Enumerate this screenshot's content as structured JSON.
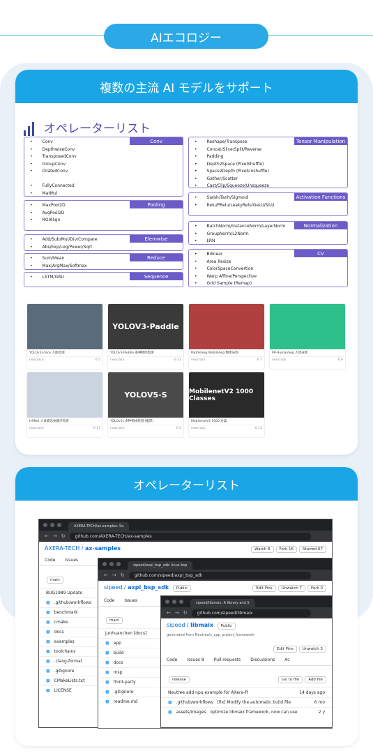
{
  "section_title": "AIエコロジー",
  "card1": {
    "title": "複数の主流 AI モデルをサポート",
    "op_title": "オペレーターリスト",
    "groups_left": [
      {
        "name": "Conv",
        "items": [
          "Conv",
          "DepthwiseConv",
          "TransposedConv",
          "GroupConv",
          "DilatedConv",
          "",
          "FullyConnected",
          "MatMul"
        ]
      },
      {
        "name": "Pooling",
        "items": [
          "MaxPool2D",
          "AvgPool2D",
          "ROIAlign"
        ]
      },
      {
        "name": "Elemwise",
        "items": [
          "Add/Sub/Mul/Div/Compare",
          "Abs/Exp/Log/Power/Sqrt"
        ]
      },
      {
        "name": "Reduce",
        "items": [
          "Sum/Mean",
          "Max/ArgMax/Softmax"
        ]
      },
      {
        "name": "Sequence",
        "items": [
          "LSTM/GRU"
        ]
      }
    ],
    "groups_right": [
      {
        "name": "Tensor Manipulation",
        "items": [
          "Reshape/Transpose",
          "Concat/Slice/Split/Reverse",
          "Padding",
          "Depth2Space (PixelShuffle)",
          "Space2Depth (PixelUnshuffle)",
          "Gather/Scatter",
          "Cast/Clip/Squeeze/Unsqueeze"
        ]
      },
      {
        "name": "Activation Functions",
        "items": [
          "Swish/Tanh/Sigmoid",
          "Relu/PRelu/LeakyRelu/GeLU/SiLU"
        ]
      },
      {
        "name": "Normalization",
        "items": [
          "BatchNorm/InstanceNorm/LayerNorm",
          "GroupNorm/L2Norm",
          "LRN"
        ]
      },
      {
        "name": "CV",
        "items": [
          "Bilinear",
          "Area Resize",
          "ColorSpaceConvertion",
          "Warp Affine/Perspective",
          "Grid Sample (Remap)"
        ]
      }
    ],
    "thumbs": [
      {
        "overlay": "",
        "caption": "YOLOv5s-face 人脸检测",
        "author": "neucrack",
        "stats": "6  5"
      },
      {
        "overlay": "YOLOV3-Paddle",
        "caption": "YOLOv3-Paddle 多种物体检测",
        "author": "neucrack",
        "stats": "6  23"
      },
      {
        "overlay": "",
        "caption": "PaddleSeg MobileSeg 物体分割",
        "author": "neucrack",
        "stats": "6  7"
      },
      {
        "overlay": "",
        "caption": "PP-HumanSeg 人体分割",
        "author": "neucrack",
        "stats": "6  6"
      },
      {
        "overlay": "",
        "caption": "HRNet 人体姿态关键点检测",
        "author": "neucrack",
        "stats": "6  17"
      },
      {
        "overlay": "YOLOV5-S",
        "caption": "YOLOv5s 多种物体检测 [推荐]",
        "author": "neucrack",
        "stats": "6  5"
      },
      {
        "overlay": "MobilenetV2 1000 Classes",
        "caption": "MobilenetV2 1000 分类",
        "author": "neucrack",
        "stats": "6  13"
      }
    ]
  },
  "card2": {
    "title": "オペレーターリスト",
    "win1": {
      "tab": "AXERA-TECH/ax-samples: Sa",
      "url": "github.com/AXERA-TECH/ax-samples",
      "repo_owner": "AXERA-TECH",
      "repo": "ax-samples",
      "tab_code": "Code",
      "tab_issues": "Issues",
      "branch": "main",
      "watch": "Watch 8",
      "fork": "Fork 16",
      "star": "Starred 67",
      "commit": "BUG1989 Update",
      "files": [
        ".github/workflows",
        "benchmark",
        "cmake",
        "docs",
        "examples",
        "toolchains",
        ".clang-format",
        ".gitignore",
        "CMakeLists.txt",
        "LICENSE"
      ]
    },
    "win2": {
      "tab": "sipeed/axpi_bsp_sdk: linux bsp",
      "url": "github.com/sipeed/axpi_bsp_sdk",
      "repo_owner": "sipeed",
      "repo": "axpi_bsp_sdk",
      "badge": "Public",
      "tab_code": "Code",
      "tab_issues": "Issues",
      "branch": "main",
      "edit_pins": "Edit Pins",
      "unwatch": "Unwatch 7",
      "fork": "Fork 0",
      "commit": "junhuanchen [docs]",
      "files": [
        "app",
        "build",
        "docs",
        "msp",
        "third-party",
        ".gitignore",
        "readme.md"
      ]
    },
    "win3": {
      "tab": "sipeed/libmaix: A library and S",
      "url": "github.com/sipeed/libmaix",
      "repo_owner": "sipeed",
      "repo": "libmaix",
      "badge": "Public",
      "generated": "generated from Neutree/c_cpp_project_framework",
      "edit_pins": "Edit Pins",
      "unwatch": "Unwatch 5",
      "tabs": [
        "Code",
        "Issues 8",
        "Pull requests",
        "Discussions",
        "Ac"
      ],
      "branch": "release",
      "goto": "Go to file",
      "addfile": "Add file",
      "commit": "Neutree add npu example for AXera-Pi",
      "commit_time": "14 days ago",
      "row2a": ".github/workflows",
      "row2b": "[fix] Modify the automatic build file",
      "row2c": "6 mo",
      "row3a": "assets/images",
      "row3b": "optimize libmaix framework, now can use",
      "row3c": "2 y"
    }
  }
}
